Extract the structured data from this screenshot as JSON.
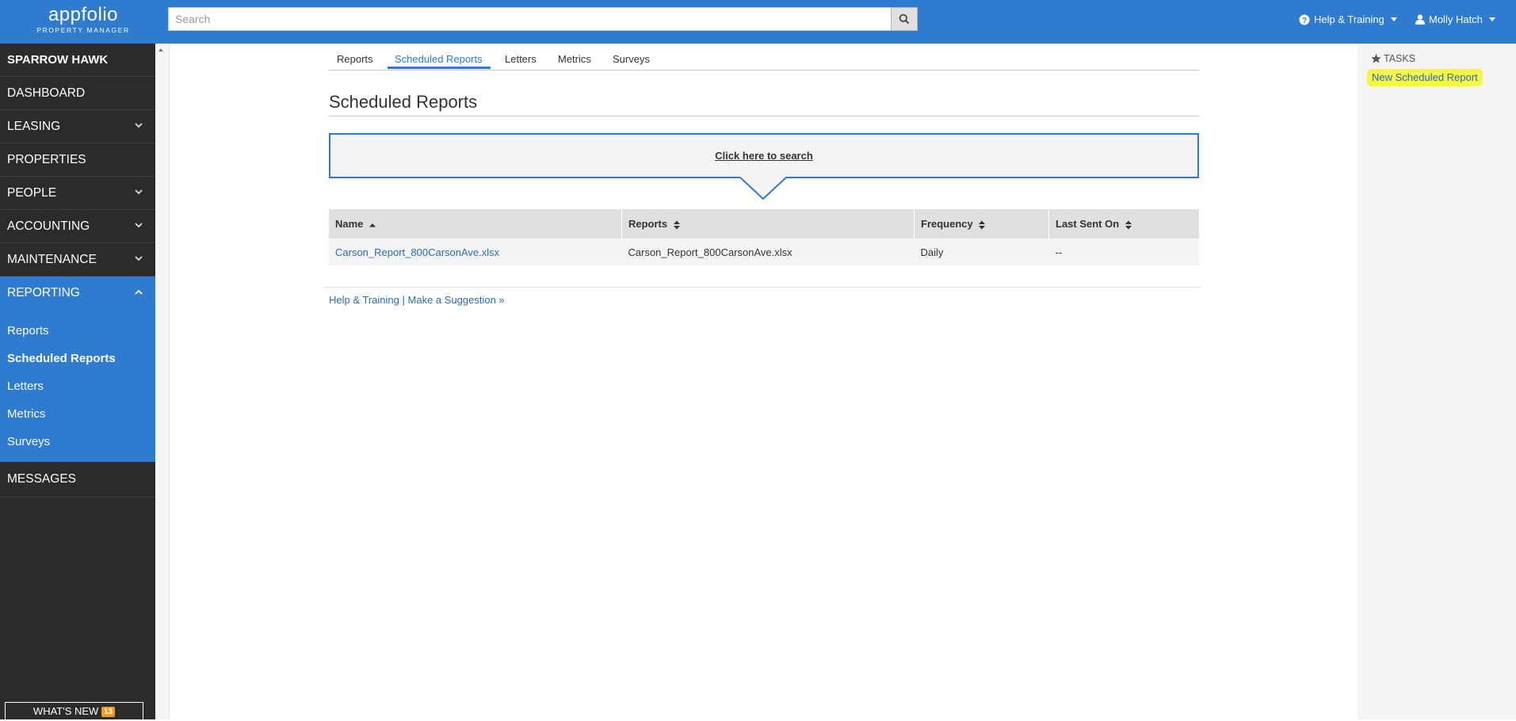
{
  "header": {
    "logo_brand": "appfolio",
    "logo_sub": "PROPERTY MANAGER",
    "search_placeholder": "Search",
    "help_label": "Help & Training",
    "user_label": "Molly Hatch",
    "color": "#2f7bd0"
  },
  "sidebar": {
    "org": "SPARROW HAWK",
    "items": [
      {
        "label": "DASHBOARD"
      },
      {
        "label": "LEASING"
      },
      {
        "label": "PROPERTIES"
      },
      {
        "label": "PEOPLE"
      },
      {
        "label": "ACCOUNTING"
      },
      {
        "label": "MAINTENANCE"
      },
      {
        "label": "REPORTING"
      },
      {
        "label": "MESSAGES"
      }
    ],
    "reporting_sub": [
      {
        "label": "Reports"
      },
      {
        "label": "Scheduled Reports"
      },
      {
        "label": "Letters"
      },
      {
        "label": "Metrics"
      },
      {
        "label": "Surveys"
      }
    ],
    "whats_new": "WHAT'S NEW",
    "whats_new_count": "13"
  },
  "tabs": [
    {
      "label": "Reports"
    },
    {
      "label": "Scheduled Reports"
    },
    {
      "label": "Letters"
    },
    {
      "label": "Metrics"
    },
    {
      "label": "Surveys"
    }
  ],
  "page": {
    "title": "Scheduled Reports",
    "search_link": "Click here to search"
  },
  "table": {
    "headers": [
      "Name",
      "Reports",
      "Frequency",
      "Last Sent On"
    ],
    "rows": [
      {
        "name": "Carson_Report_800CarsonAve.xlsx",
        "reports": "Carson_Report_800CarsonAve.xlsx",
        "frequency": "Daily",
        "last_sent": "--"
      }
    ]
  },
  "footer": {
    "help": "Help & Training",
    "separator": "|",
    "suggest": "Make a Suggestion »"
  },
  "tasks": {
    "title": "TASKS",
    "new_link": "New Scheduled Report",
    "highlight_color": "#f5f54a"
  }
}
